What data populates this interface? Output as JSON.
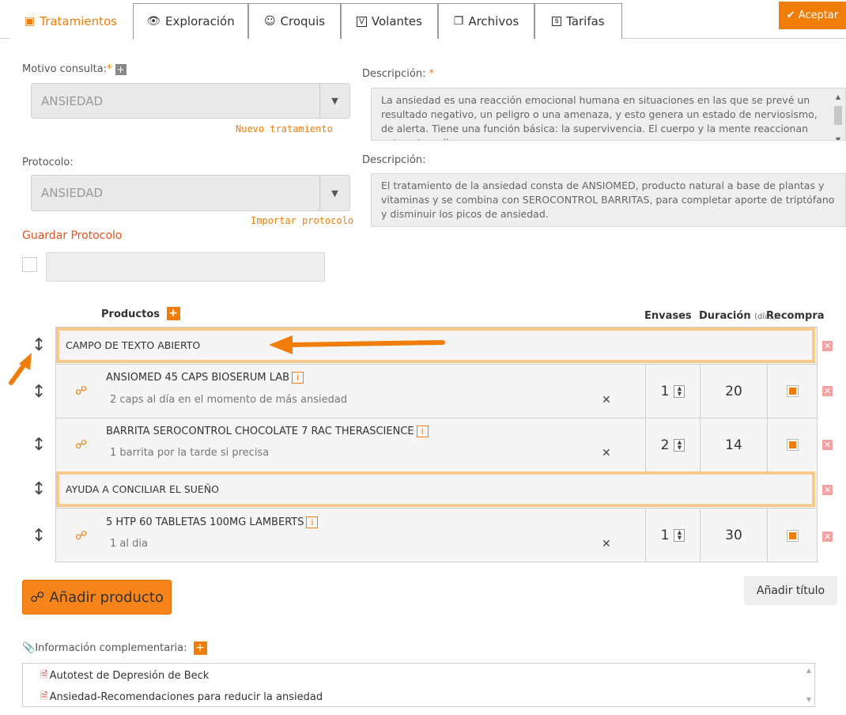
{
  "tabs": [
    {
      "label": "Tratamientos",
      "icon": "medical-kit-icon"
    },
    {
      "label": "Exploración",
      "icon": "eye-icon"
    },
    {
      "label": "Croquis",
      "icon": "face-icon"
    },
    {
      "label": "Volantes",
      "icon": "document-v-icon"
    },
    {
      "label": "Archivos",
      "icon": "files-icon"
    },
    {
      "label": "Tarifas",
      "icon": "money-icon"
    }
  ],
  "accept_label": "Aceptar",
  "motivo": {
    "label": "Motivo consulta:",
    "value": "ANSIEDAD",
    "link": "Nuevo tratamiento"
  },
  "descripcion1": {
    "label": "Descripción:",
    "text": "La ansiedad es una reacción emocional humana en situaciones en las que se prevé un resultado negativo, un peligro o una amenaza, y esto genera un estado de nerviosismo, de alerta. Tiene una función básica: la supervivencia. El cuerpo y la mente reaccionan ante este peligro."
  },
  "protocolo": {
    "label": "Protocolo:",
    "value": "ANSIEDAD",
    "link": "Importar protocolo",
    "save_label": "Guardar Protocolo"
  },
  "descripcion2": {
    "label": "Descripción:",
    "text": "El tratamiento de la ansiedad consta de ANSIOMED, producto natural a base de plantas y vitaminas y se combina con SEROCONTROL BARRITAS, para completar aporte de triptófano y disminuir los picos de ansiedad."
  },
  "products_header": {
    "productos": "Productos",
    "envases": "Envases",
    "duracion": "Duración",
    "duracion_unit": "(días)",
    "recompra": "Recompra"
  },
  "rows": [
    {
      "type": "title",
      "text": "CAMPO DE TEXTO ABIERTO"
    },
    {
      "type": "product",
      "name": "ANSIOMED 45 CAPS BIOSERUM LAB",
      "note": "2 caps al día en el momento de más ansiedad",
      "envases": "1",
      "duracion": "20",
      "recompra": true
    },
    {
      "type": "product",
      "name": "BARRITA SEROCONTROL CHOCOLATE 7 RAC THERASCIENCE",
      "note": "1 barrita por la tarde si precisa",
      "envases": "2",
      "duracion": "14",
      "recompra": true
    },
    {
      "type": "title",
      "text": "AYUDA A CONCILIAR EL SUEÑO"
    },
    {
      "type": "product",
      "name": "5 HTP 60 TABLETAS 100MG LAMBERTS",
      "note": "1 al dia",
      "envases": "1",
      "duracion": "30",
      "recompra": true
    }
  ],
  "add_product_label": "Añadir producto",
  "add_title_label": "Añadir título",
  "info": {
    "label": "Información complementaria:",
    "items": [
      "Autotest de Depresión de Beck",
      "Ansiedad-Recomendaciones para reducir la ansiedad"
    ]
  },
  "colors": {
    "accent": "#f07d0a",
    "title_border": "#f9c98b",
    "delete": "#f2a2a0"
  }
}
